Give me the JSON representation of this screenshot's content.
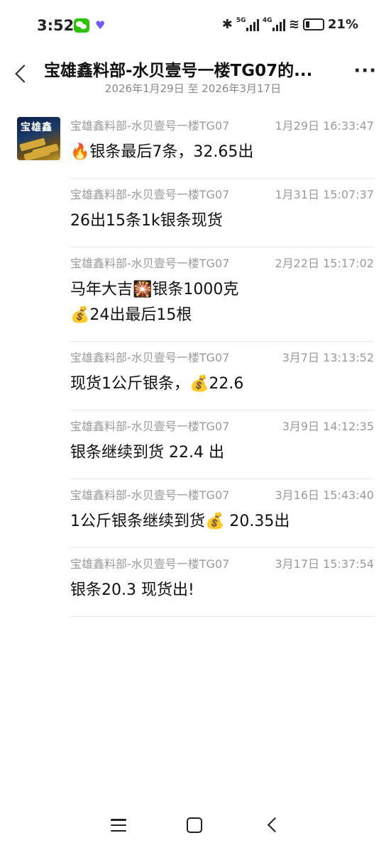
{
  "status_bar": {
    "time": "3:52",
    "battery": "21%",
    "network_1": "5G",
    "network_2": "4G"
  },
  "header": {
    "title": "宝雄鑫料部-水贝壹号一楼TG07的...",
    "subtitle": "2026年1月29日 至 2026年3月17日"
  },
  "avatar": {
    "text": "宝雄鑫"
  },
  "messages": [
    {
      "sender": "宝雄鑫料部-水贝壹号一楼TG07",
      "time": "1月29日 16:33:47",
      "lines": [
        "🔥银条最后7条，32.65出"
      ]
    },
    {
      "sender": "宝雄鑫料部-水贝壹号一楼TG07",
      "time": "1月31日 15:07:37",
      "lines": [
        "26出15条1k银条现货"
      ]
    },
    {
      "sender": "宝雄鑫料部-水贝壹号一楼TG07",
      "time": "2月22日 15:17:02",
      "lines": [
        "马年大吉🎇银条1000克",
        "💰24出最后15根"
      ]
    },
    {
      "sender": "宝雄鑫料部-水贝壹号一楼TG07",
      "time": "3月7日 13:13:52",
      "lines": [
        "现货1公斤银条，💰22.6"
      ]
    },
    {
      "sender": "宝雄鑫料部-水贝壹号一楼TG07",
      "time": "3月9日 14:12:35",
      "lines": [
        "银条继续到货 22.4 出"
      ]
    },
    {
      "sender": "宝雄鑫料部-水贝壹号一楼TG07",
      "time": "3月16日 15:43:40",
      "lines": [
        "1公斤银条继续到货💰 20.35出"
      ]
    },
    {
      "sender": "宝雄鑫料部-水贝壹号一楼TG07",
      "time": "3月17日 15:37:54",
      "lines": [
        "银条20.3 现货出!"
      ]
    }
  ]
}
